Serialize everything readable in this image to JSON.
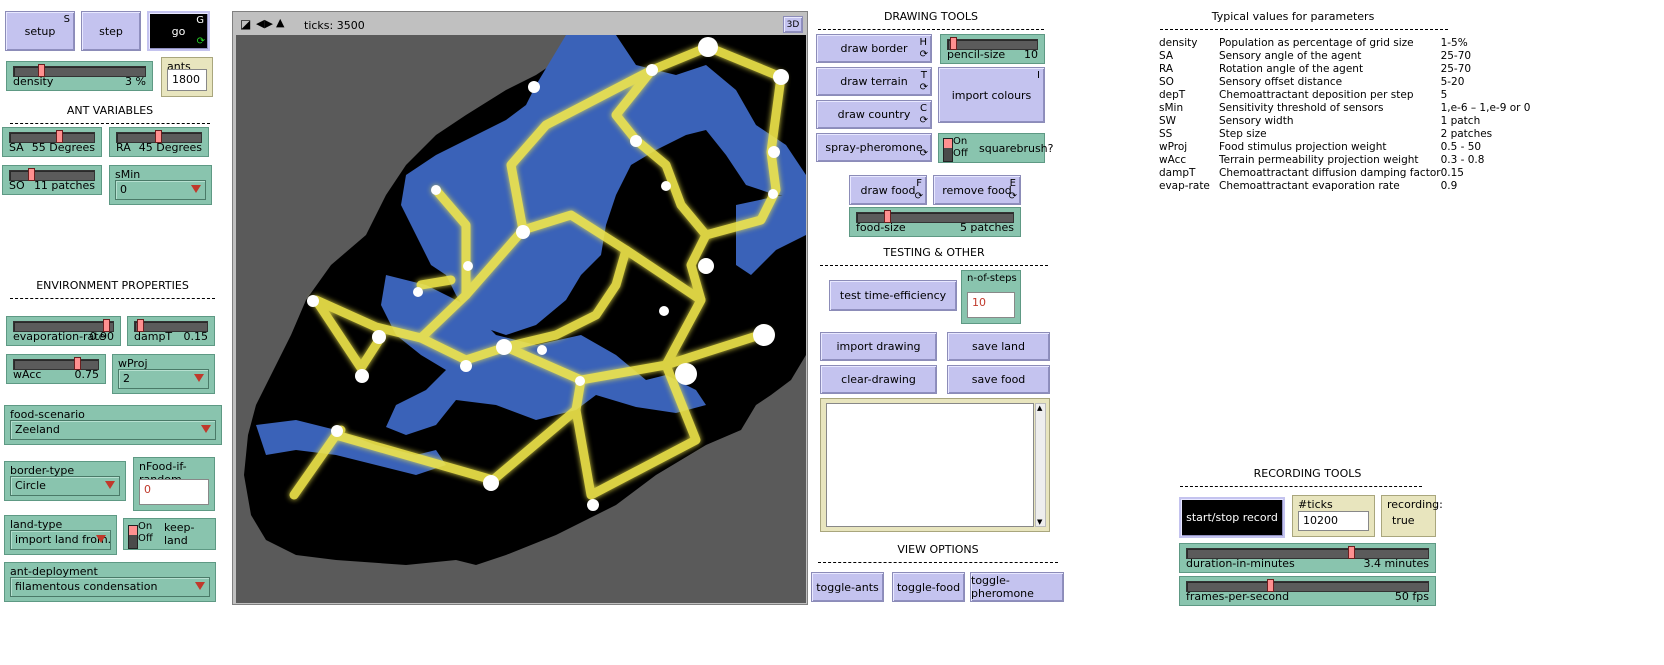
{
  "buttons": {
    "setup": {
      "label": "setup",
      "key": "S"
    },
    "step": {
      "label": "step"
    },
    "go": {
      "label": "go",
      "key": "G"
    },
    "draw_border": {
      "label": "draw border",
      "key": "H"
    },
    "draw_terrain": {
      "label": "draw terrain",
      "key": "T"
    },
    "draw_country": {
      "label": "draw country",
      "key": "C"
    },
    "spray_pheromone": {
      "label": "spray-pheromone"
    },
    "import_colours": {
      "label": "import colours",
      "key": "I"
    },
    "draw_food": {
      "label": "draw food",
      "key": "F"
    },
    "remove_food": {
      "label": "remove food",
      "key": "E"
    },
    "test_time": {
      "label": "test time-efficiency"
    },
    "import_drawing": {
      "label": "import drawing"
    },
    "save_land": {
      "label": "save land"
    },
    "clear_drawing": {
      "label": "clear-drawing"
    },
    "save_food": {
      "label": "save food"
    },
    "toggle_ants": {
      "label": "toggle-ants"
    },
    "toggle_food": {
      "label": "toggle-food"
    },
    "toggle_pheromone": {
      "label": "toggle-pheromone"
    },
    "record": {
      "label": "start/stop record"
    }
  },
  "sliders": {
    "density": {
      "label": "density",
      "value_text": "3 %",
      "fraction": 0.2
    },
    "sa": {
      "label": "SA",
      "value_text": "55 Degrees",
      "fraction": 0.55
    },
    "ra": {
      "label": "RA",
      "value_text": "45 Degrees",
      "fraction": 0.45
    },
    "so": {
      "label": "SO",
      "value_text": "11 patches",
      "fraction": 0.2
    },
    "evap": {
      "label": "evaporation-rate",
      "value_text": "0.90",
      "fraction": 0.9
    },
    "dampT": {
      "label": "dampT",
      "value_text": "0.15",
      "fraction": 0.05
    },
    "wAcc": {
      "label": "wAcc",
      "value_text": "0.75",
      "fraction": 0.75
    },
    "pencil": {
      "label": "pencil-size",
      "value_text": "10",
      "fraction": 0.05
    },
    "foodsize": {
      "label": "food-size",
      "value_text": "5 patches",
      "fraction": 0.2
    },
    "duration": {
      "label": "duration-in-minutes",
      "value_text": "3.4 minutes",
      "fraction": 0.67
    },
    "fps": {
      "label": "frames-per-second",
      "value_text": "50 fps",
      "fraction": 0.33
    }
  },
  "inputs": {
    "ants": {
      "label": "ants",
      "value": "1800"
    },
    "nFood": {
      "label": "nFood-if-random",
      "value": "0"
    },
    "nsteps": {
      "label": "n-of-steps",
      "value": "10"
    },
    "ticks_rec": {
      "label": "#ticks recording:",
      "value": "10200"
    },
    "recording": {
      "label": "recording:",
      "value": "true"
    }
  },
  "choosers": {
    "sMin": {
      "label": "sMin",
      "value": "0"
    },
    "wProj": {
      "label": "wProj",
      "value": "2"
    },
    "food_scenario": {
      "label": "food-scenario",
      "value": "Zeeland"
    },
    "border_type": {
      "label": "border-type",
      "value": "Circle"
    },
    "land_type": {
      "label": "land-type",
      "value": "import land from..."
    },
    "ant_deploy": {
      "label": "ant-deployment",
      "value": "filamentous condensation"
    }
  },
  "switches": {
    "keep_land": {
      "on": "On",
      "off": "Off",
      "label": "keep-land"
    },
    "squarebrush": {
      "on": "On",
      "off": "Off",
      "label": "squarebrush?"
    }
  },
  "notes": {
    "ant_vars": "ANT VARIABLES",
    "env_props": "ENVIRONMENT PROPERTIES",
    "drawing_tools": "DRAWING TOOLS",
    "testing": "TESTING & OTHER",
    "view_options": "VIEW OPTIONS",
    "recording_tools": "RECORDING TOOLS",
    "typical": "Typical values for parameters"
  },
  "view": {
    "ticks_text": "ticks: 3500",
    "btn_3d": "3D"
  },
  "params": [
    {
      "name": "density",
      "desc": "Population as percentage of grid size",
      "value": "1-5%"
    },
    {
      "name": "SA",
      "desc": "Sensory angle of the agent",
      "value": "25-70"
    },
    {
      "name": "RA",
      "desc": "Rotation angle of the agent",
      "value": "25-70"
    },
    {
      "name": "SO",
      "desc": "Sensory offset distance",
      "value": "5-20"
    },
    {
      "name": "depT",
      "desc": "Chemoattractant deposition per step",
      "value": "5"
    },
    {
      "name": "sMin",
      "desc": "Sensitivity threshold of sensors",
      "value": "1,e-6 – 1,e-9 or 0"
    },
    {
      "name": "SW",
      "desc": "Sensory width",
      "value": "1 patch"
    },
    {
      "name": "SS",
      "desc": "Step size",
      "value": "2 patches"
    },
    {
      "name": "wProj",
      "desc": "Food stimulus projection weight",
      "value": "0.5 - 50"
    },
    {
      "name": "wAcc",
      "desc": "Terrain permeability projection weight",
      "value": "0.3 - 0.8"
    },
    {
      "name": "dampT",
      "desc": "Chemoattractant diffusion damping factor",
      "value": "0.15"
    },
    {
      "name": "evap-rate",
      "desc": "Chemoattractant evaporation rate",
      "value": "0.9"
    }
  ],
  "colors": {
    "button": "#c4c3ef",
    "widget": "#89c4ae",
    "input": "#e8e5be",
    "land": "#000000",
    "water": "#3a62b8",
    "outside": "#5a5a5a",
    "pheromone": "#f2e84b",
    "food": "#ffffff"
  },
  "icons": {
    "forever": "forever-arrows-icon",
    "zoom": "zoom-icon",
    "arrows": "speed-arrows-icon"
  }
}
